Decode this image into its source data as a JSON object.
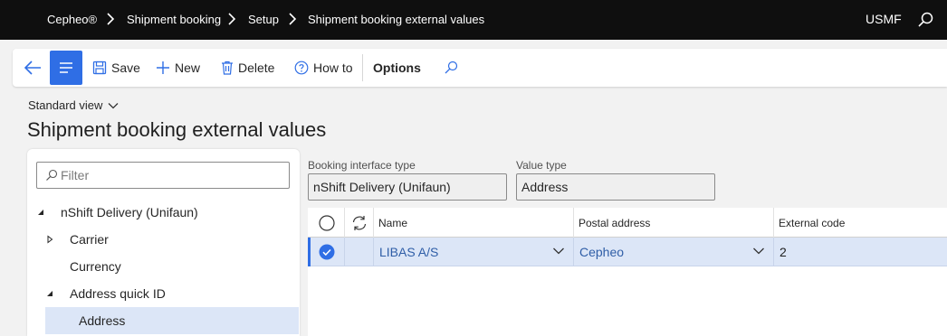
{
  "nav": {
    "crumbs": [
      "Cepheo®",
      "Shipment booking",
      "Setup",
      "Shipment booking external values"
    ],
    "company": "USMF"
  },
  "actions": {
    "save": "Save",
    "new": "New",
    "delete": "Delete",
    "howto": "How to",
    "options": "Options"
  },
  "page": {
    "view": "Standard view",
    "title": "Shipment booking external values"
  },
  "tree": {
    "filter_placeholder": "Filter",
    "nodes": [
      {
        "label": "nShift Delivery (Unifaun)",
        "state": "expanded"
      },
      {
        "label": "Carrier",
        "state": "collapsed"
      },
      {
        "label": "Currency",
        "state": "leaf"
      },
      {
        "label": "Address quick ID",
        "state": "expanded"
      },
      {
        "label": "Address",
        "state": "selected"
      }
    ]
  },
  "fields": {
    "booking_interface_type": {
      "label": "Booking interface type",
      "value": "nShift Delivery (Unifaun)"
    },
    "value_type": {
      "label": "Value type",
      "value": "Address"
    }
  },
  "grid": {
    "columns": [
      "Name",
      "Postal address",
      "External code"
    ],
    "rows": [
      {
        "name": "LIBAS A/S",
        "postal_address": "Cepheo",
        "external_code": "2",
        "selected": true
      }
    ]
  },
  "colors": {
    "accent": "#2f6ee5",
    "topbar": "#0f0f0f",
    "selection": "#dce6f7",
    "link": "#2f5ea7"
  }
}
